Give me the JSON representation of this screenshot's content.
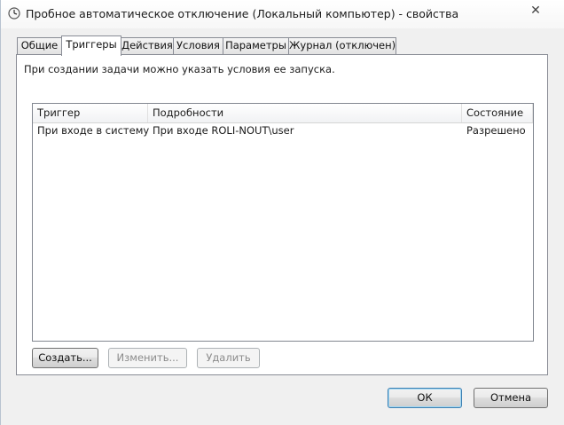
{
  "window": {
    "title": "Пробное автоматическое отключение (Локальный компьютер) - свойства",
    "close_glyph": "✕"
  },
  "tabs": [
    {
      "label": "Общие"
    },
    {
      "label": "Триггеры"
    },
    {
      "label": "Действия"
    },
    {
      "label": "Условия"
    },
    {
      "label": "Параметры"
    },
    {
      "label": "Журнал (отключен)"
    }
  ],
  "active_tab": "Триггеры",
  "panel": {
    "description": "При создании задачи можно указать условия ее запуска."
  },
  "triggers_table": {
    "columns": [
      "Триггер",
      "Подробности",
      "Состояние"
    ],
    "rows": [
      [
        "При входе в систему",
        "При входе ROLI-NOUT\\user",
        "Разрешено"
      ]
    ]
  },
  "actions": {
    "create": "Создать...",
    "edit": "Изменить...",
    "delete": "Удалить"
  },
  "dialog": {
    "ok": "ОК",
    "cancel": "Отмена"
  },
  "icons": {
    "title_icon": "clock-icon",
    "close": "close-icon"
  }
}
